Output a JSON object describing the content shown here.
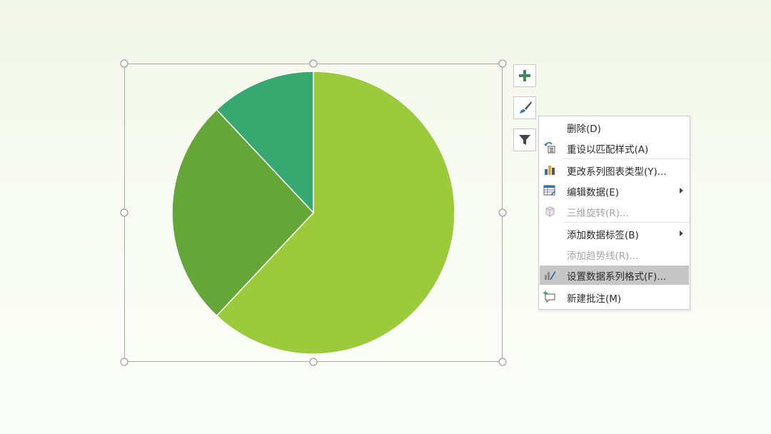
{
  "chart_data": {
    "type": "pie",
    "slices": [
      {
        "value": 62,
        "color": "#9bcb3b"
      },
      {
        "value": 26,
        "color": "#64a637"
      },
      {
        "value": 12,
        "color": "#36a870"
      }
    ]
  },
  "side_buttons": {
    "add": "chart-elements",
    "style": "chart-styles",
    "filter": "chart-filters"
  },
  "context_menu": {
    "items": [
      {
        "label": "删除(D)",
        "icon": "none",
        "disabled": false,
        "submenu": false
      },
      {
        "label": "重设以匹配样式(A)",
        "icon": "reset-style-icon",
        "disabled": false,
        "submenu": false
      },
      {
        "label": "更改系列图表类型(Y)...",
        "icon": "chart-type-icon",
        "disabled": false,
        "submenu": false
      },
      {
        "label": "编辑数据(E)",
        "icon": "edit-data-icon",
        "disabled": false,
        "submenu": true
      },
      {
        "label": "三维旋转(R)...",
        "icon": "3d-rotation-icon",
        "disabled": true,
        "submenu": false
      },
      {
        "label": "添加数据标签(B)",
        "icon": "none",
        "disabled": false,
        "submenu": true
      },
      {
        "label": "添加趋势线(R)...",
        "icon": "none",
        "disabled": true,
        "submenu": false
      },
      {
        "label": "设置数据系列格式(F)...",
        "icon": "format-series-icon",
        "disabled": false,
        "submenu": false,
        "highlighted": true
      },
      {
        "label": "新建批注(M)",
        "icon": "new-comment-icon",
        "disabled": false,
        "submenu": false
      }
    ]
  }
}
